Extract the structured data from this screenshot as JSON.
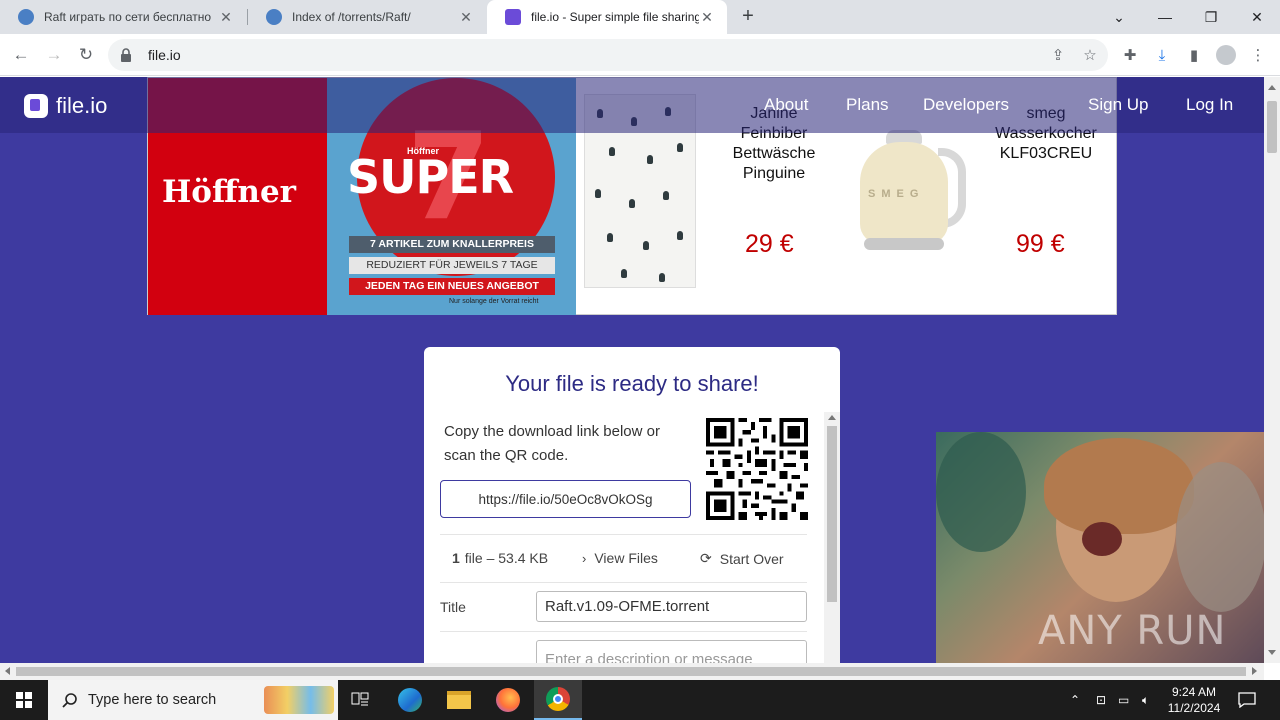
{
  "browser": {
    "tabs": [
      {
        "title": "Raft играть по сети бесплатно",
        "active": false
      },
      {
        "title": "Index of /torrents/Raft/",
        "active": false
      },
      {
        "title": "file.io - Super simple file sharing",
        "active": true
      }
    ],
    "url": "file.io"
  },
  "site": {
    "brand": "file.io",
    "nav": [
      "About",
      "Plans",
      "Developers",
      "Sign Up",
      "Log In"
    ]
  },
  "ad": {
    "hoffner_logo": "Höffner",
    "brand_small": "Höffner",
    "super_text": "SUPER",
    "super_num": "7",
    "line1": "7 ARTIKEL ZUM KNALLERPREIS",
    "line2": "REDUZIERT FÜR JEWEILS 7 TAGE",
    "line3": "JEDEN TAG EIN NEUES ANGEBOT",
    "footnote": "Nur solange der Vorrat reicht",
    "product1": {
      "name": "Janine Feinbiber Bettwäsche Pinguine",
      "price": "29 €"
    },
    "product2": {
      "name": "smeg Wasserkocher KLF03CREU",
      "price": "99 €",
      "kettle_brand": "SMEG"
    }
  },
  "card": {
    "heading": "Your file is ready to share!",
    "instructions": "Copy the download link below or scan the QR code.",
    "link": "https://file.io/50eOc8vOkOSg",
    "file_count": "1",
    "file_meta": "file – 53.4 KB",
    "view_files": "View Files",
    "start_over": "Start Over",
    "title_label": "Title",
    "title_value": "Raft.v1.09-OFME.torrent",
    "description_placeholder": "Enter a description or message"
  },
  "video": {
    "watermark": "ANY RUN"
  },
  "taskbar": {
    "search_placeholder": "Type here to search",
    "time": "9:24 AM",
    "date": "11/2/2024"
  },
  "colors": {
    "page_bg": "#3e3aa0",
    "heading": "#2d2b84",
    "price": "#c00000",
    "hoffner_red": "#d2000f"
  }
}
